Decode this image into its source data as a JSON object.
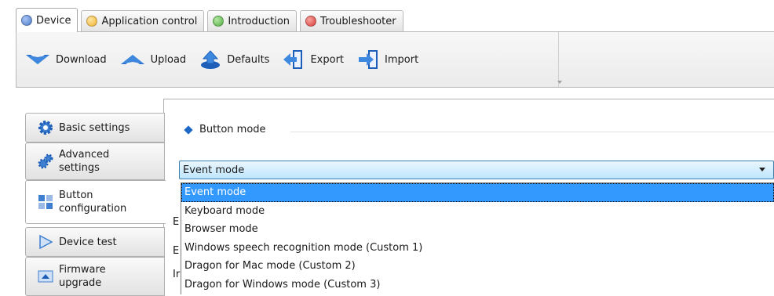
{
  "tabs": [
    {
      "label": "Device",
      "dot": "#4b79c9",
      "active": true
    },
    {
      "label": "Application control",
      "dot": "#f2b02e",
      "active": false
    },
    {
      "label": "Introduction",
      "dot": "#4fae3f",
      "active": false
    },
    {
      "label": "Troubleshooter",
      "dot": "#d93a36",
      "active": false
    }
  ],
  "toolbar": {
    "download": "Download",
    "upload": "Upload",
    "defaults": "Defaults",
    "export": "Export",
    "import": "Import"
  },
  "sidenav": [
    {
      "label": "Basic settings",
      "icon": "gear-icon"
    },
    {
      "label": "Advanced settings",
      "icon": "gears-icon"
    },
    {
      "label": "Button configuration",
      "icon": "button-config-icon",
      "active": true
    },
    {
      "label": "Device test",
      "icon": "play-icon"
    },
    {
      "label": "Firmware upgrade",
      "icon": "firmware-icon"
    }
  ],
  "group": {
    "title": "Button mode"
  },
  "combo": {
    "value": "Event mode"
  },
  "dropdown": {
    "options": [
      "Event mode",
      "Keyboard mode",
      "Browser mode",
      "Windows speech recognition mode (Custom 1)",
      "Dragon for Mac mode (Custom 2)",
      "Dragon for Windows mode (Custom 3)"
    ],
    "selected_index": 0
  },
  "peek": {
    "a": "E",
    "b": "E",
    "c": "Ir"
  },
  "colors": {
    "accent": "#1e68c7",
    "selection": "#3399ff",
    "combo_border": "#3c7fb1"
  }
}
